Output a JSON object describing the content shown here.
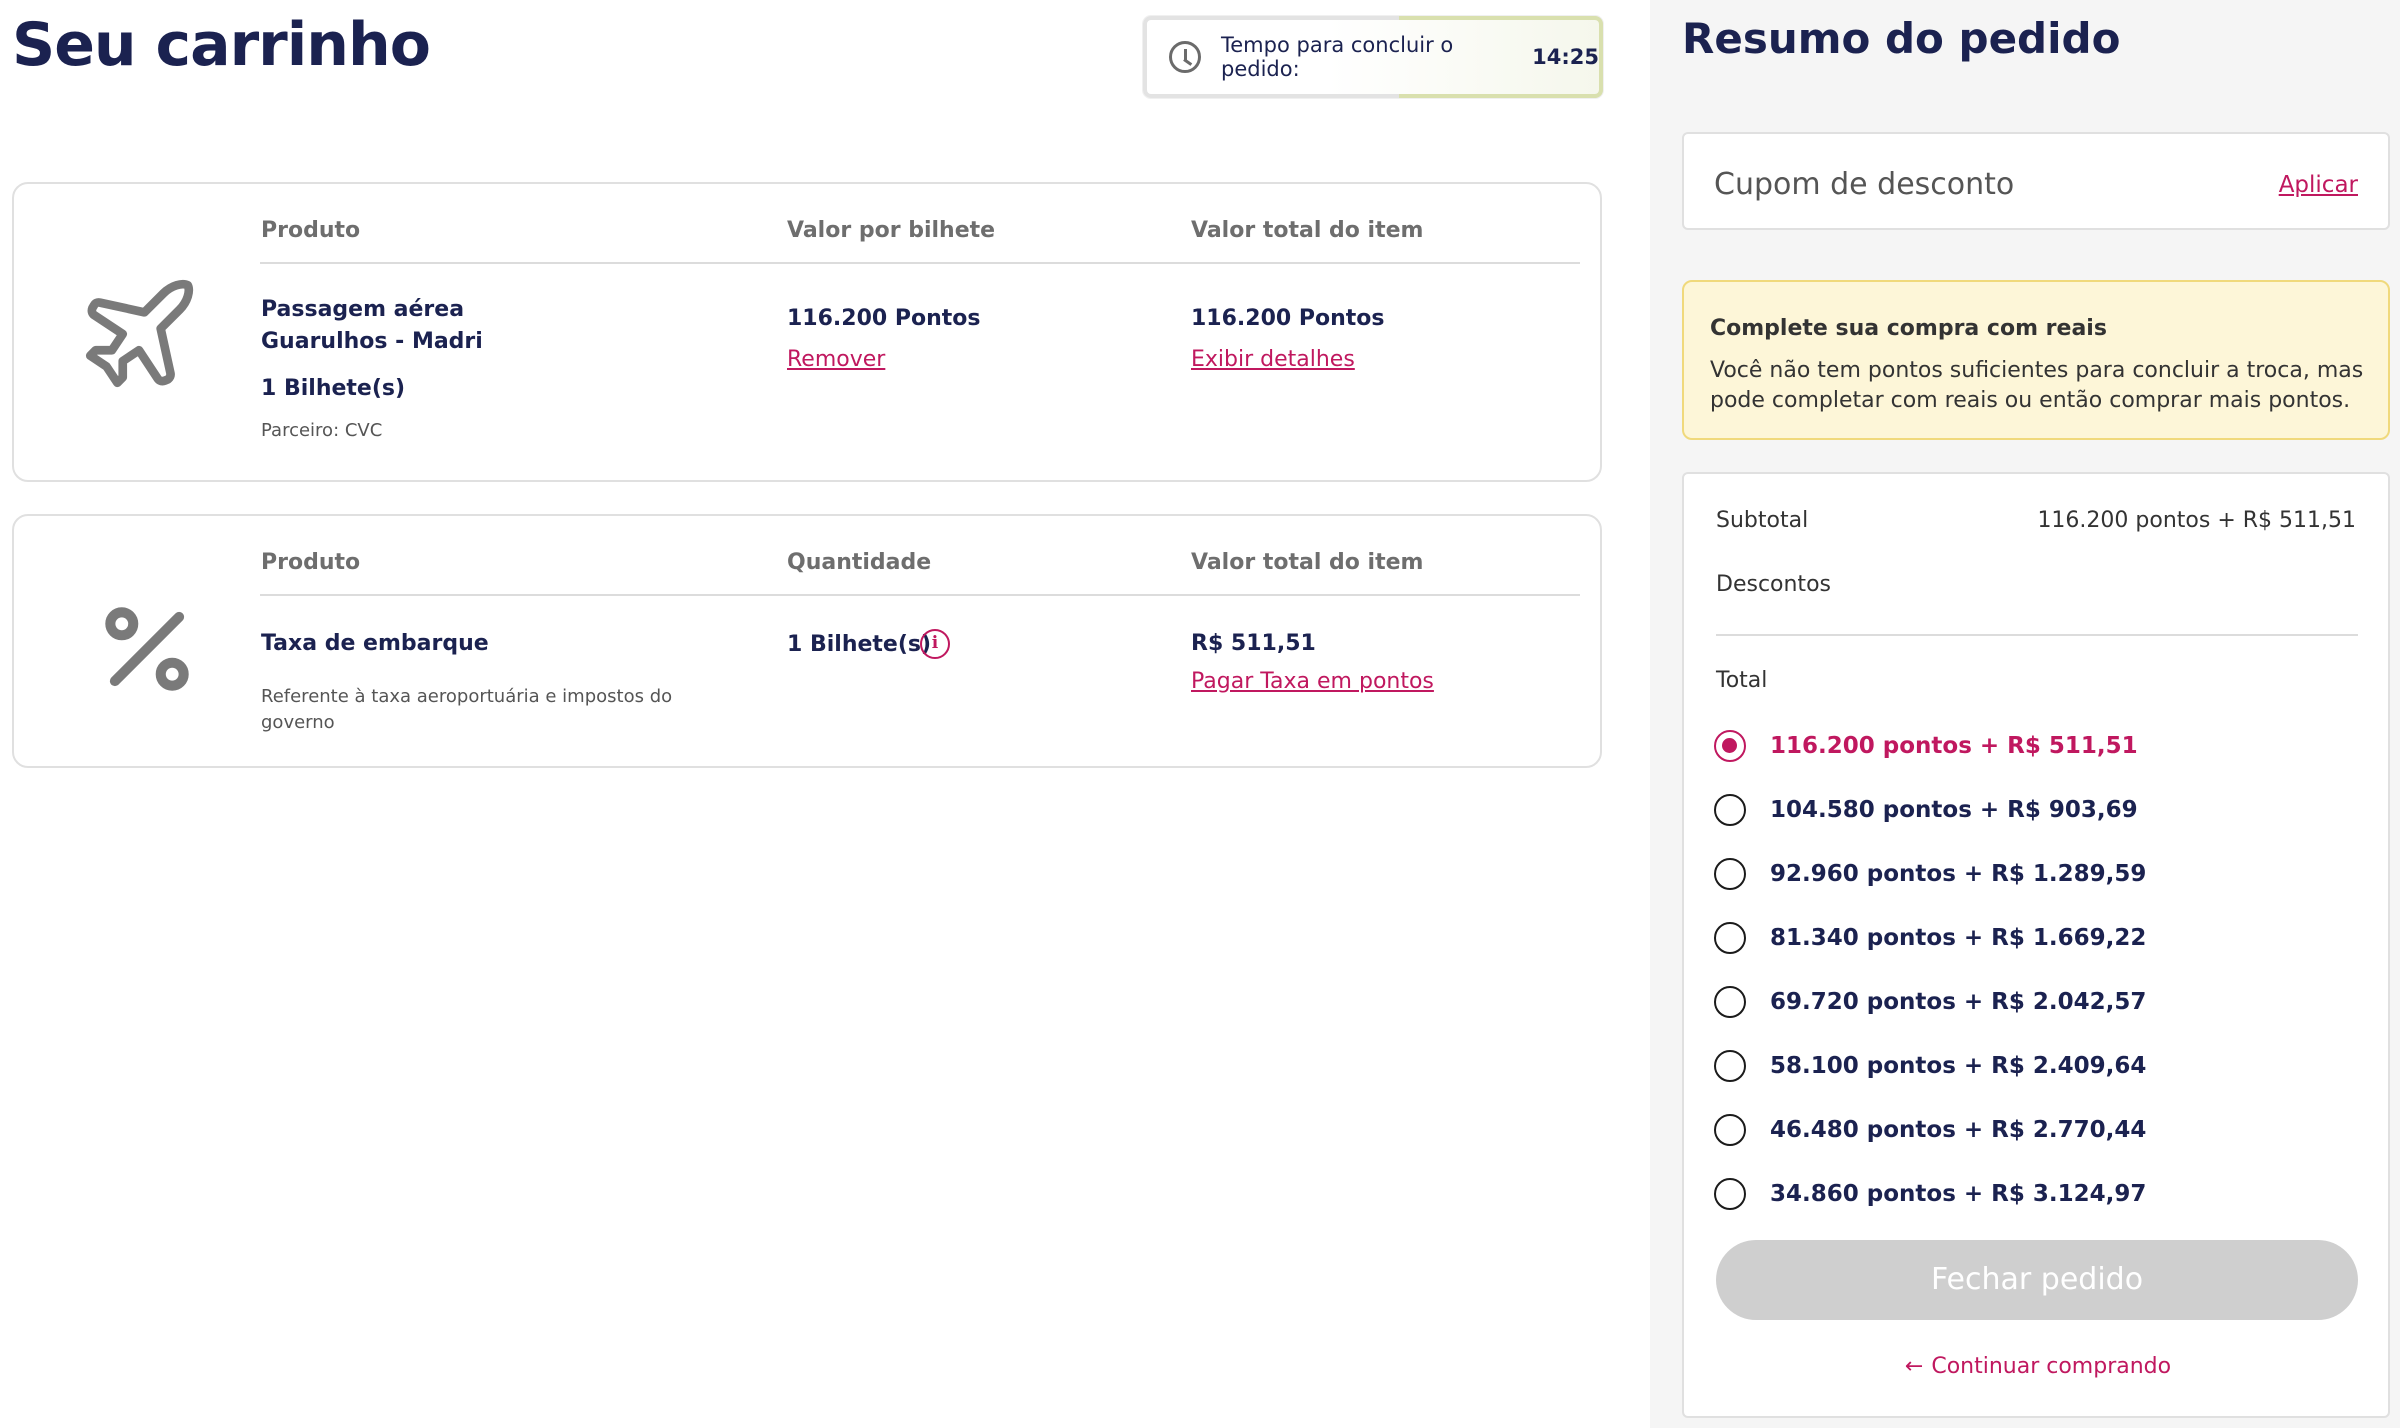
{
  "cart": {
    "title": "Seu carrinho",
    "timer": {
      "label": "Tempo para concluir o pedido:",
      "value": "14:25",
      "icon": "clock-icon"
    },
    "items": [
      {
        "icon": "airplane-icon",
        "headers": [
          "Produto",
          "Valor por bilhete",
          "Valor total do item"
        ],
        "name_line1": "Passagem aérea",
        "name_line2": "Guarulhos - Madri",
        "tickets": "1 Bilhete(s)",
        "partner": "Parceiro: CVC",
        "unit_value": "116.200 Pontos",
        "remove_link": "Remover",
        "total_value": "116.200 Pontos",
        "details_link": "Exibir detalhes"
      },
      {
        "icon": "percent-icon",
        "headers": [
          "Produto",
          "Quantidade",
          "Valor total do item"
        ],
        "name": "Taxa de embarque",
        "description": "Referente à taxa aeroportuária e impostos do governo",
        "quantity": "1 Bilhete(s)",
        "info_icon": "info-icon",
        "total_value": "R$ 511,51",
        "pay_link": "Pagar Taxa em pontos"
      }
    ]
  },
  "summary": {
    "title": "Resumo do pedido",
    "coupon": {
      "placeholder": "Cupom de desconto",
      "apply": "Aplicar"
    },
    "alert": {
      "title": "Complete sua compra com reais",
      "text": "Você não tem pontos suficientes para concluir a troca, mas pode completar com reais ou então comprar mais pontos."
    },
    "subtotal_label": "Subtotal",
    "subtotal_value": "116.200 pontos + R$ 511,51",
    "discounts_label": "Descontos",
    "total_label": "Total",
    "options": [
      "116.200 pontos + R$ 511,51",
      "104.580 pontos + R$ 903,69",
      "92.960 pontos + R$ 1.289,59",
      "81.340 pontos + R$ 1.669,22",
      "69.720 pontos + R$ 2.042,57",
      "58.100 pontos + R$ 2.409,64",
      "46.480 pontos + R$ 2.770,44",
      "34.860 pontos + R$ 3.124,97"
    ],
    "selected_option": 0,
    "close_button": "Fechar pedido",
    "continue_link": "Continuar comprando",
    "continue_icon": "arrow-left-icon"
  },
  "colors": {
    "brand_pink": "#c0185f",
    "navy": "#1b2250",
    "alert_bg": "#fdf6d8",
    "disabled_button": "#cfcfcf"
  }
}
